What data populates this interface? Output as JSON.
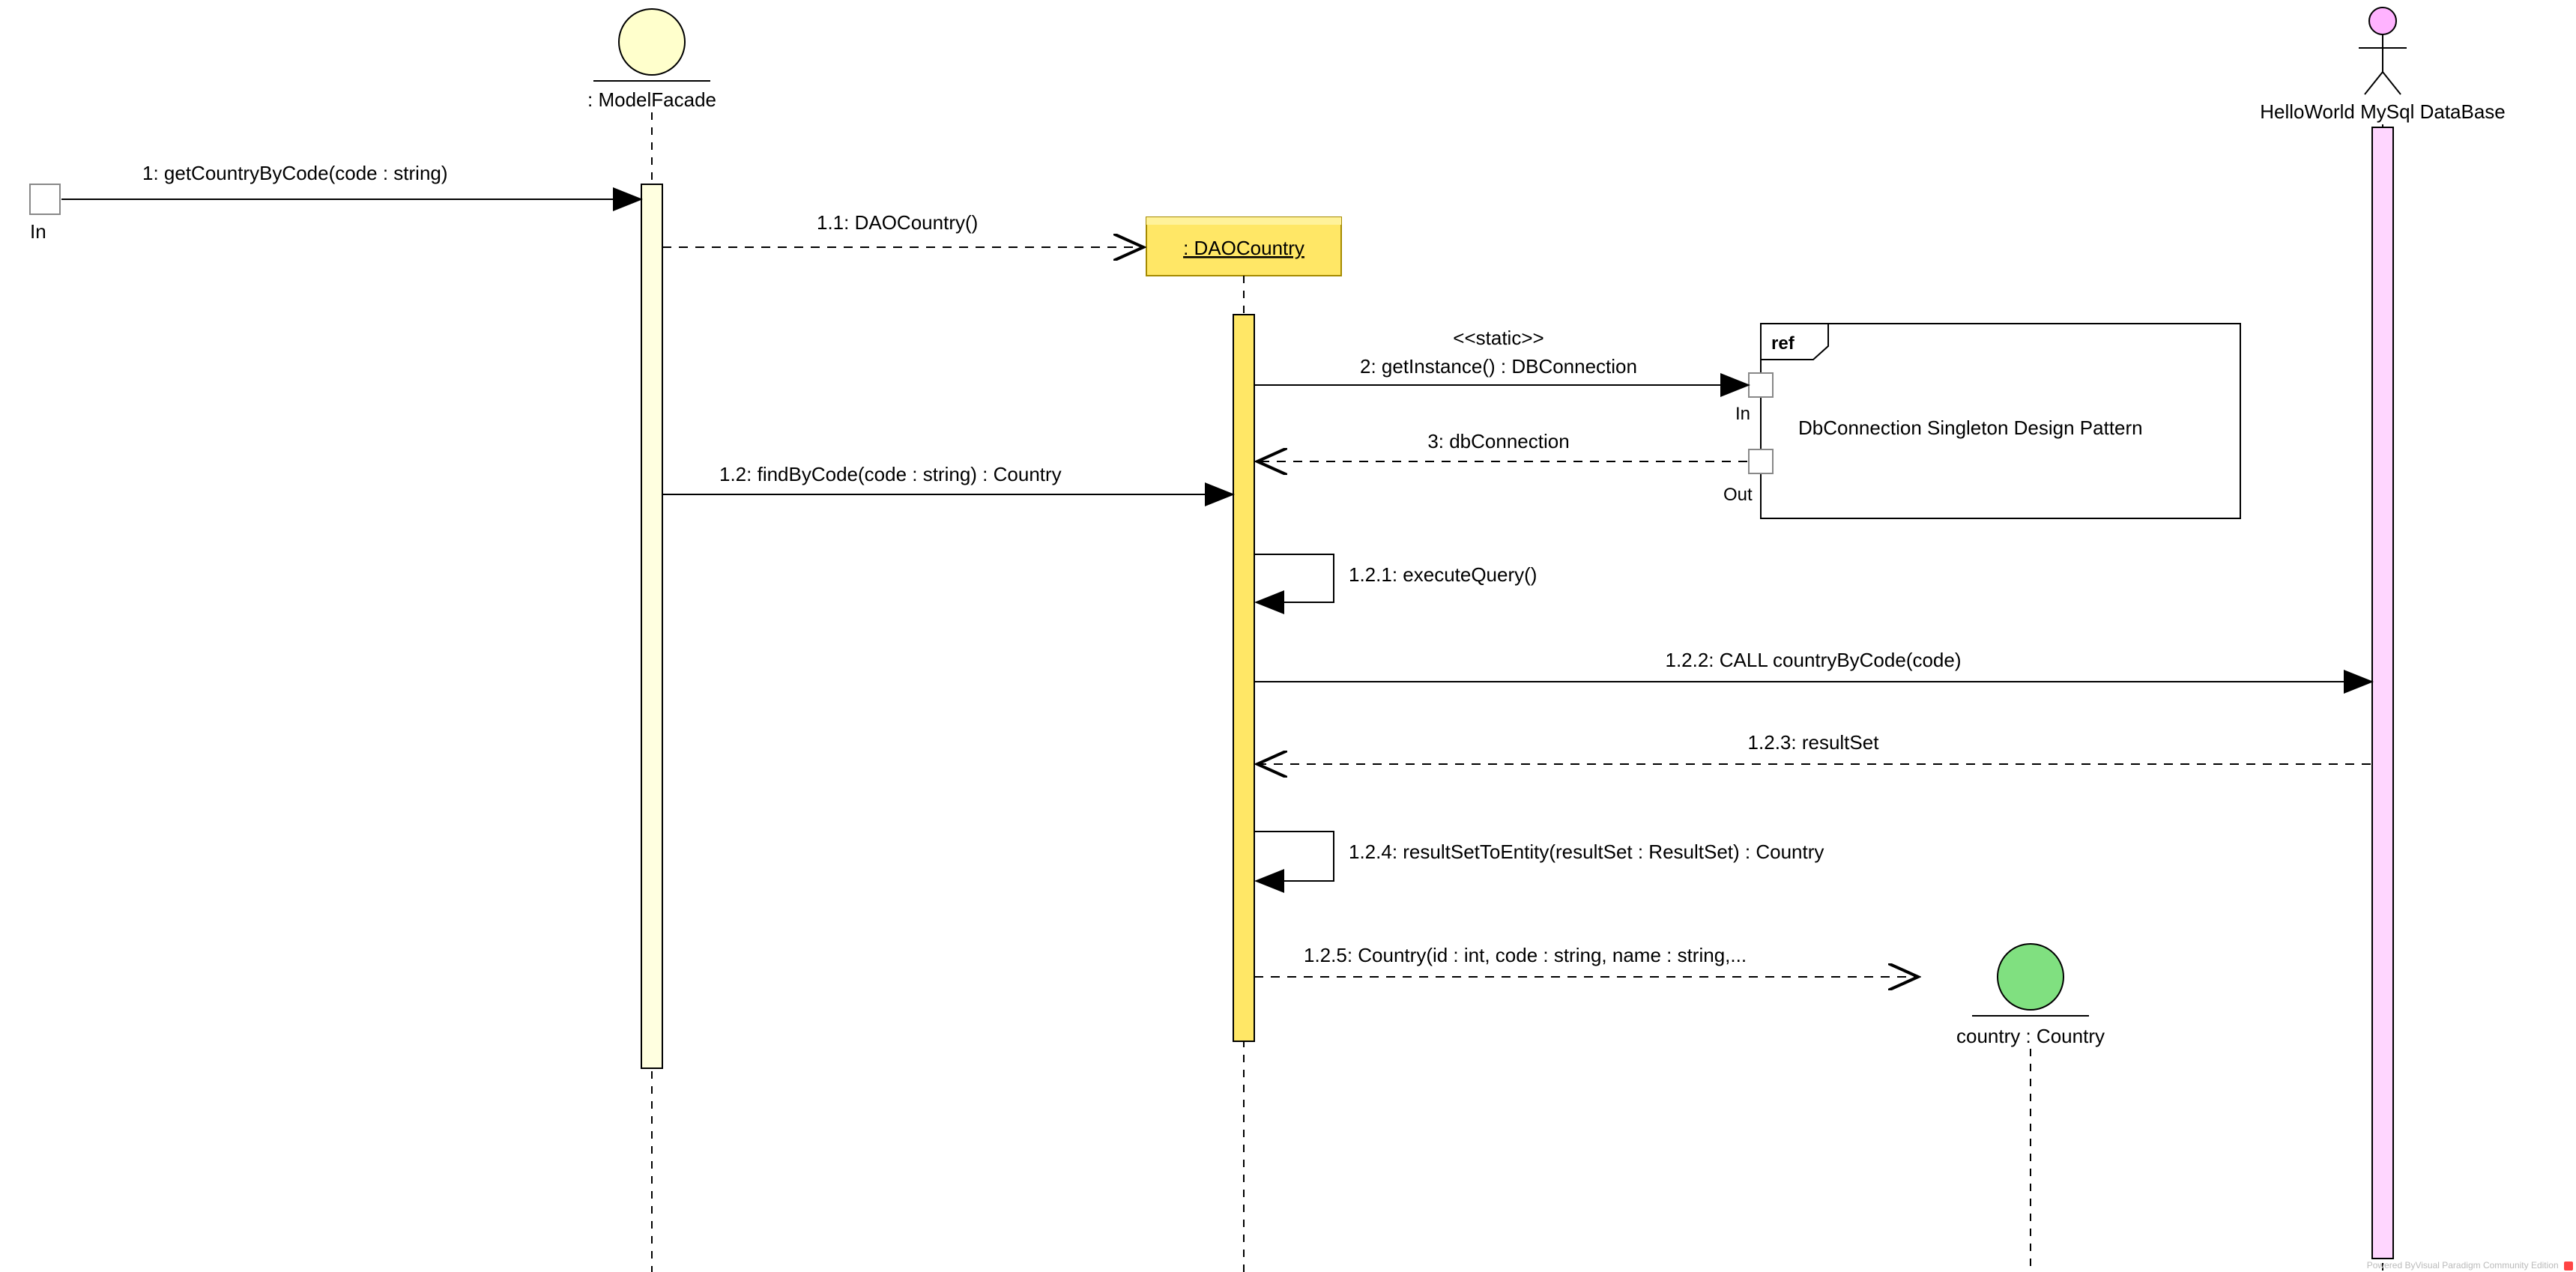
{
  "lifelines": {
    "in": {
      "label": "In"
    },
    "modelFacade": {
      "label": ": ModelFacade"
    },
    "daoCountry": {
      "label": ": DAOCountry"
    },
    "db": {
      "label": "HelloWorld MySql DataBase"
    },
    "country": {
      "label": "country : Country"
    }
  },
  "messages": {
    "m1": "1: getCountryByCode(code : string)",
    "m1_1": "1.1: DAOCountry()",
    "m2_stereo": "<<static>>",
    "m2": "2: getInstance() : DBConnection",
    "m3": "3: dbConnection",
    "m1_2": "1.2: findByCode(code : string) : Country",
    "m1_2_1": "1.2.1: executeQuery()",
    "m1_2_2": "1.2.2: CALL countryByCode(code)",
    "m1_2_3": "1.2.3: resultSet",
    "m1_2_4": "1.2.4: resultSetToEntity(resultSet : ResultSet) : Country",
    "m1_2_5": "1.2.5: Country(id : int, code : string, name : string,..."
  },
  "ref": {
    "tag": "ref",
    "inLabel": "In",
    "outLabel": "Out",
    "title": "DbConnection Singleton Design Pattern"
  },
  "watermark": "Powered ByVisual Paradigm Community Edition"
}
